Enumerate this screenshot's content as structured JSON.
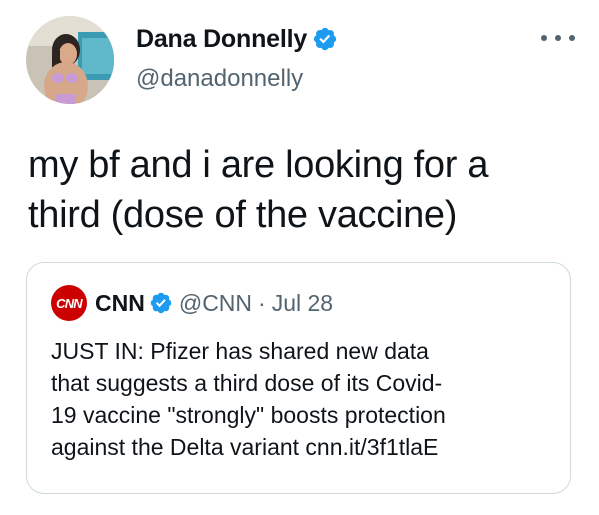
{
  "author": {
    "display_name": "Dana Donnelly",
    "handle": "@danadonnelly",
    "verified": true,
    "avatar_icon": "profile-photo"
  },
  "tweet": {
    "text": "my bf and i are looking for a\nthird (dose of the vaccine)"
  },
  "more_icon": "ellipsis-icon",
  "quoted_tweet": {
    "logo_text": "CNN",
    "display_name": "CNN",
    "handle": "@CNN",
    "separator": "·",
    "date": "Jul 28",
    "verified": true,
    "text": "JUST IN: Pfizer has shared new data\nthat suggests a third dose of its Covid-\n19 vaccine \"strongly\" boosts protection\nagainst the Delta variant cnn.it/3f1tlaE"
  },
  "colors": {
    "verified_blue": "#1d9bf0",
    "secondary_text": "#536471",
    "border": "#cfd9de",
    "cnn_red": "#cc0000"
  }
}
